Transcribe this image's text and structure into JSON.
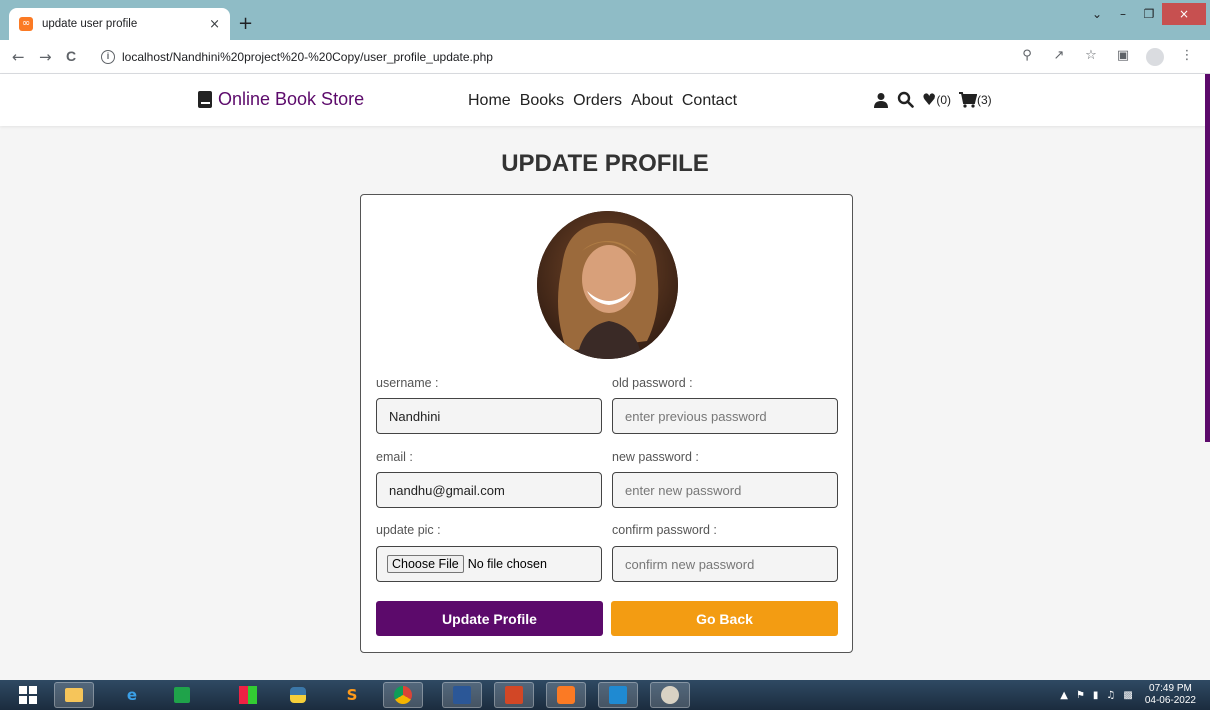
{
  "browser": {
    "tab_title": "update user profile",
    "tab_close": "×",
    "new_tab": "+",
    "url": "localhost/Nandhini%20project%20-%20Copy/user_profile_update.php",
    "back": "←",
    "forward": "→",
    "reload": "C",
    "win_minimize": "–",
    "win_restore": "❐",
    "win_close": "×",
    "win_chevron": "⌄"
  },
  "site": {
    "logo_text": "Online Book Store",
    "nav": [
      "Home",
      "Books",
      "Orders",
      "About",
      "Contact"
    ],
    "wishlist_count": "(0)",
    "cart_count": "(3)"
  },
  "page": {
    "title": "UPDATE PROFILE"
  },
  "form": {
    "username_label": "username :",
    "username_value": "Nandhini",
    "email_label": "email :",
    "email_value": "nandhu@gmail.com",
    "update_pic_label": "update pic :",
    "choose_file_label": "Choose File",
    "no_file_text": "No file chosen",
    "old_password_label": "old password :",
    "old_password_placeholder": "enter previous password",
    "new_password_label": "new password :",
    "new_password_placeholder": "enter new password",
    "confirm_password_label": "confirm password :",
    "confirm_password_placeholder": "confirm new password",
    "update_button": "Update Profile",
    "back_button": "Go Back"
  },
  "taskbar": {
    "time": "07:49 PM",
    "date": "04-06-2022"
  },
  "colors": {
    "brand_purple": "#5c0a6b",
    "button_orange": "#f39c12",
    "tab_strip": "#8fbcc6"
  }
}
